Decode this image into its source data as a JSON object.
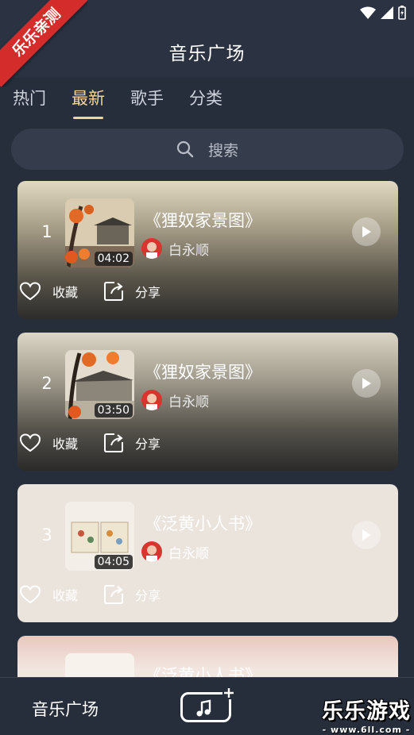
{
  "ribbon": "乐乐亲测",
  "header": {
    "title": "音乐广场"
  },
  "tabs": [
    {
      "label": "热门",
      "active": false
    },
    {
      "label": "最新",
      "active": true
    },
    {
      "label": "歌手",
      "active": false
    },
    {
      "label": "分类",
      "active": false
    }
  ],
  "search": {
    "placeholder": "搜索"
  },
  "songs": [
    {
      "rank": "1",
      "title": "《狸奴家景图》",
      "artist": "白永顺",
      "duration": "04:02"
    },
    {
      "rank": "2",
      "title": "《狸奴家景图》",
      "artist": "白永顺",
      "duration": "03:50"
    },
    {
      "rank": "3",
      "title": "《泛黄小人书》",
      "artist": "白永顺",
      "duration": "04:05"
    },
    {
      "title": "《泛黄小人书》"
    }
  ],
  "actions": {
    "favorite": "收藏",
    "share": "分享"
  },
  "bottom_nav": {
    "label": "音乐广场"
  },
  "watermark": {
    "title": "乐乐游戏",
    "url": "- www.6ll.com -"
  },
  "colors": {
    "background": "#262d3b",
    "accent": "#f2d49a",
    "ribbon": "#d42b2b"
  }
}
